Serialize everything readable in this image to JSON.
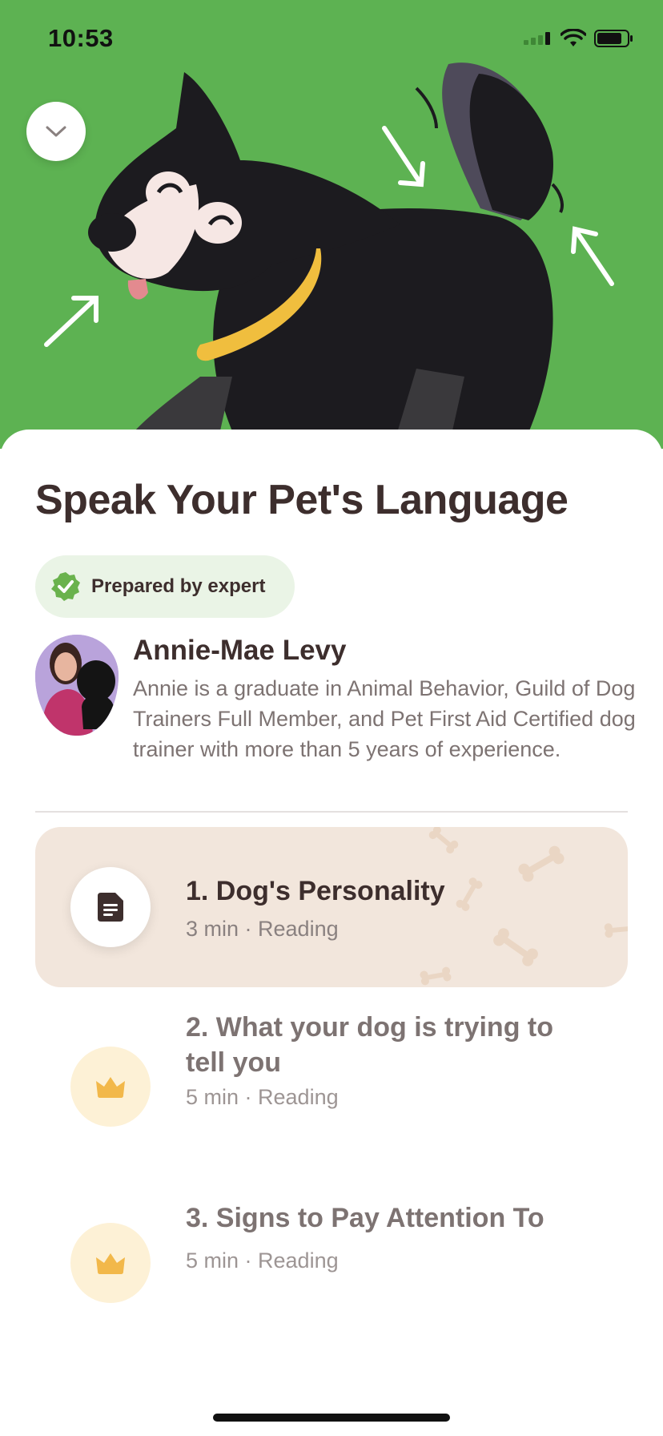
{
  "status_bar": {
    "time": "10:53"
  },
  "hero": {
    "collapse_icon": "chevron-down-icon",
    "illustration": "dog-illustration",
    "background": "#5db252"
  },
  "course": {
    "title": "Speak Your Pet's Language",
    "badge": {
      "label": "Prepared by expert",
      "icon": "verified-check-icon",
      "color": "#6ab24d"
    }
  },
  "author": {
    "name": "Annie-Mae Levy",
    "bio": "Annie is a graduate in Animal Behavior, Guild of Dog Trainers Full Member, and Pet First Aid Certified dog trainer with more than 5 years of experience."
  },
  "lessons": [
    {
      "title": "1. Dog's Personality",
      "meta": "3 min · Reading",
      "icon": "document-icon",
      "state": "active"
    },
    {
      "title": "2. What your dog is trying to tell you",
      "meta": "5 min · Reading",
      "icon": "crown-icon",
      "state": "locked"
    },
    {
      "title": "3. Signs to Pay Attention To",
      "meta": "5 min · Reading",
      "icon": "crown-icon",
      "state": "locked"
    }
  ],
  "colors": {
    "title": "#3d2e2d",
    "active_card": "#f2e6dc",
    "premium": "#f2b84a"
  }
}
